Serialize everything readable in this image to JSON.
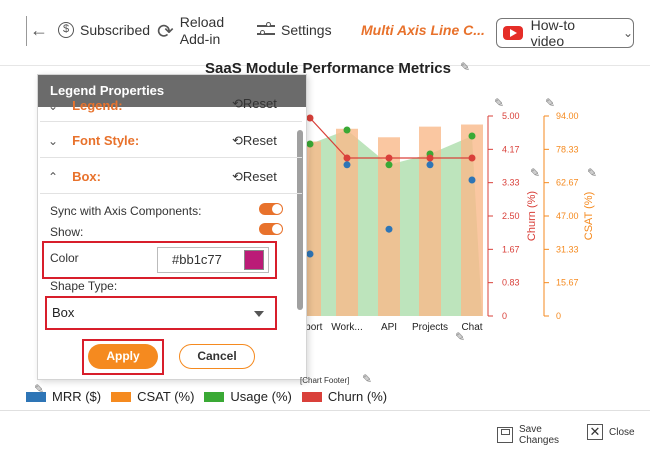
{
  "toolbar": {
    "subscribed": "Subscribed",
    "reload_line1": "Reload",
    "reload_line2": "Add-in",
    "settings": "Settings",
    "app_title": "Multi Axis Line C...",
    "howto": "How-to video"
  },
  "colors": {
    "accent": "#e8722c",
    "highlight": "#d81e2b",
    "mrr": "#2e75b6",
    "csat": "#f58a1f",
    "usage": "#3aa935",
    "churn": "#d9403a",
    "selected_color": "#bb1c77"
  },
  "icons": [
    "hamburger-icon",
    "back-arrow-icon",
    "dollar-circle-icon",
    "reload-icon",
    "settings-sliders-icon",
    "youtube-icon",
    "chevron-down-icon",
    "pencil-icon",
    "reset-icon",
    "save-icon",
    "close-icon"
  ],
  "panel": {
    "title": "Legend Properties",
    "sections": [
      {
        "name": "Legend:",
        "reset": "Reset"
      },
      {
        "name": "Font Style:",
        "reset": "Reset"
      },
      {
        "name": "Box:",
        "reset": "Reset"
      }
    ],
    "sync_label": "Sync with Axis Components:",
    "show_label": "Show:",
    "color_label": "Color",
    "color_value": "#bb1c77",
    "shape_label": "Shape Type:",
    "shape_value": "Box",
    "apply": "Apply",
    "cancel": "Cancel"
  },
  "chart_data": {
    "type": "bar",
    "title": "SaaS Module Performance Metrics",
    "categories": [
      "Support",
      "Work...",
      "API",
      "Projects",
      "Chat"
    ],
    "category_labels_visible": [
      "pport",
      "Work...",
      "API",
      "Projects",
      "Chat"
    ],
    "series": [
      {
        "name": "MRR ($)",
        "type": "scatter",
        "color": "#2e75b6",
        "values": [
          1.55,
          3.78,
          2.17,
          3.78,
          3.4
        ]
      },
      {
        "name": "CSAT (%)",
        "type": "bar",
        "axis": "csat",
        "color": "#f58a1f",
        "values": [
          82,
          88,
          84,
          89,
          90
        ]
      },
      {
        "name": "Usage (%)",
        "type": "area",
        "color": "#3aa935",
        "values": [
          4.3,
          4.65,
          3.78,
          4.05,
          4.5
        ]
      },
      {
        "name": "Churn (%)",
        "type": "line",
        "axis": "churn",
        "color": "#d9403a",
        "values": [
          4.95,
          3.95,
          3.95,
          3.95,
          3.95
        ]
      }
    ],
    "churn_axis": {
      "label": "Churn (%)",
      "ticks": [
        "5.00",
        "4.17",
        "3.33",
        "2.50",
        "1.67",
        "0.83",
        "0"
      ],
      "ylim": [
        0,
        5
      ]
    },
    "csat_axis": {
      "label": "CSAT (%)",
      "ticks": [
        "94.00",
        "78.33",
        "62.67",
        "47.00",
        "31.33",
        "15.67",
        "0"
      ],
      "ylim": [
        0,
        94
      ]
    },
    "footer": "[Chart Footer]"
  },
  "legend": [
    "MRR ($)",
    "CSAT (%)",
    "Usage (%)",
    "Churn (%)"
  ],
  "bottom": {
    "save_line1": "Save",
    "save_line2": "Changes",
    "close": "Close"
  }
}
